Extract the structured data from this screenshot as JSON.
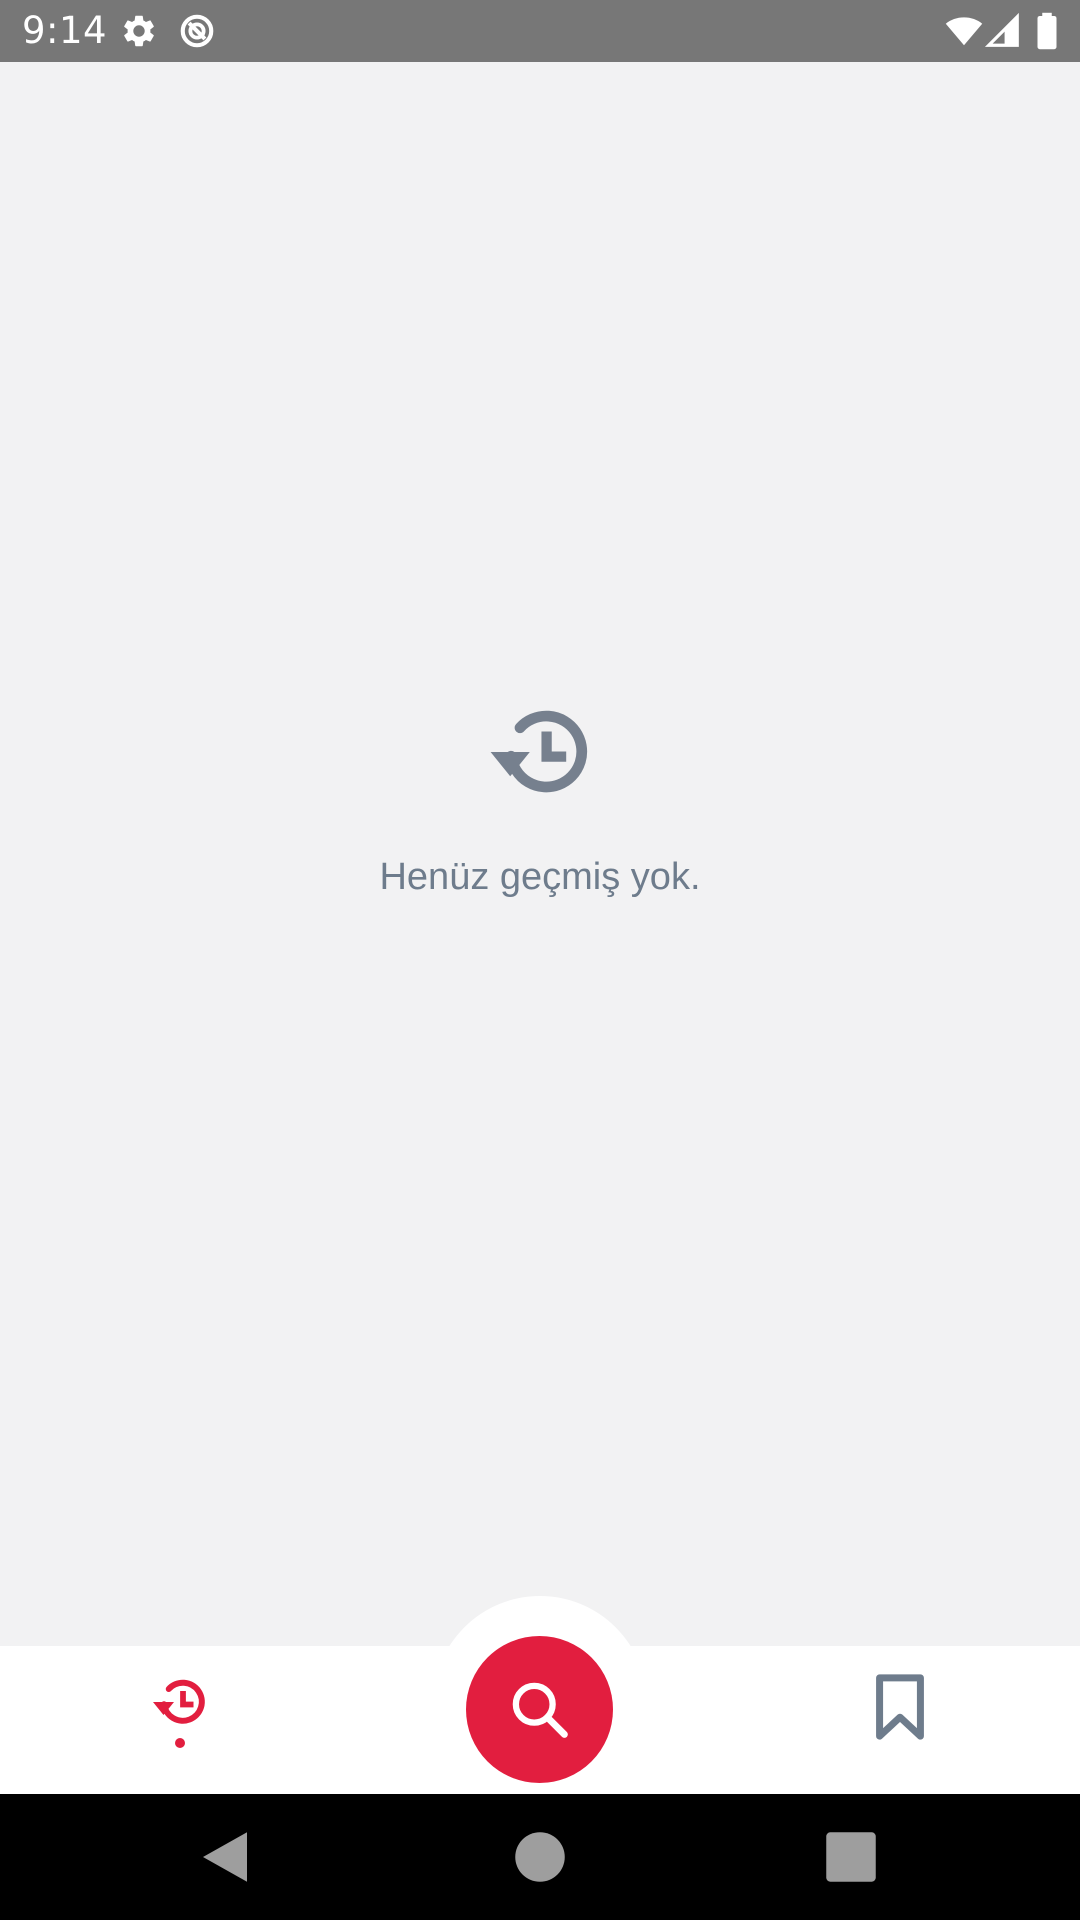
{
  "status_bar": {
    "time": "9:14",
    "icons": [
      "gear-icon",
      "data-saver-icon",
      "wifi-icon",
      "cell-signal-icon",
      "battery-icon"
    ]
  },
  "empty_state": {
    "icon": "history-icon",
    "message": "Henüz geçmiş yok."
  },
  "bottom_nav": {
    "items": [
      {
        "icon": "history-icon",
        "active": true
      },
      {
        "icon": "search-icon"
      },
      {
        "icon": "bookmark-icon",
        "active": false
      }
    ]
  },
  "system_nav": {
    "buttons": [
      "back-icon",
      "home-icon",
      "recents-icon"
    ]
  },
  "colors": {
    "accent": "#e21e3f",
    "muted": "#6e7c8c",
    "background": "#f2f2f3",
    "status_bar": "#777777"
  }
}
